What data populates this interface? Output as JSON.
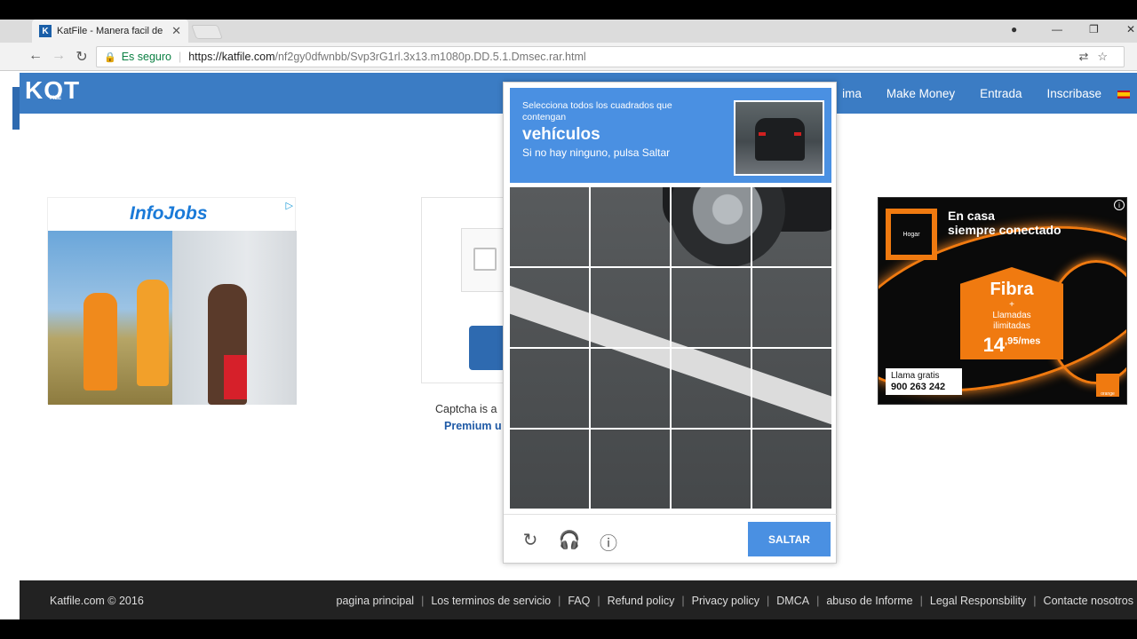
{
  "browser": {
    "tab_title": "KatFile - Manera facil de",
    "tab_favicon": "K",
    "secure_label": "Es seguro",
    "url_host": "https://katfile.com",
    "url_path": "/nf2gy0dfwnbb/Svp3rG1rl.3x13.m1080p.DD.5.1.Dmsec.rar.html"
  },
  "header": {
    "logo": "KOT",
    "logo_sub": "FILE",
    "nav": [
      "ima",
      "Make Money",
      "Entrada",
      "Inscribase"
    ]
  },
  "ad_left": {
    "brand": "InfoJobs"
  },
  "ad_right": {
    "home_label": "Hogar",
    "headline_1": "En casa",
    "headline_2": "siempre conectado",
    "fibra": "Fibra",
    "plus": "+",
    "llamadas_1": "Llamadas",
    "llamadas_2": "ilimitadas",
    "price_main": "14",
    "price_cents": ",95",
    "price_unit": "/mes",
    "call_label": "Llama gratis",
    "phone": "900 263 242",
    "brand": "orange"
  },
  "captcha_bg": {
    "note": "Captcha is a",
    "premium": "Premium u"
  },
  "recaptcha": {
    "instruction": "Selecciona todos los cuadrados que contengan",
    "target": "vehículos",
    "subtext": "Si no hay ninguno, pulsa Saltar",
    "skip_label": "SALTAR",
    "tiles": 16,
    "header_color": "#4a90e2"
  },
  "footer": {
    "copyright": "Katfile.com © 2016",
    "links": [
      "pagina principal",
      "Los terminos de servicio",
      "FAQ",
      "Refund policy",
      "Privacy policy",
      "DMCA",
      "abuso de Informe",
      "Legal Responsbility",
      "Contacte nosotros"
    ]
  }
}
